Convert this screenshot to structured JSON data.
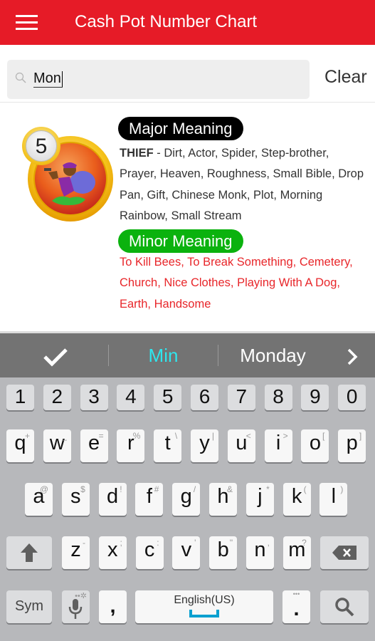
{
  "app": {
    "title": "Cash Pot Number Chart",
    "menu_icon": "hamburger-menu-icon",
    "accent_color": "#e61b27"
  },
  "search": {
    "icon": "search-icon",
    "value": "Mon",
    "placeholder": "",
    "clear_label": "Clear"
  },
  "result": {
    "number": "5",
    "image": "thief-ball-icon",
    "major_label": "Major Meaning",
    "major_keyword": "THIEF",
    "major_rest": " - Dirt, Actor, Spider, Step-brother, Prayer, Heaven, Roughness, Small Bible, Drop Pan, Gift, Chinese Monk, Plot, Morning Rainbow, Small Stream",
    "minor_label": "Minor Meaning",
    "minor_text": "To Kill Bees, To Break Something, Cemetery, Church, Nice Clothes, Playing With A Dog, Earth, Handsome",
    "major_color": "#000000",
    "minor_color": "#0bb20e",
    "minor_text_color": "#e8262a"
  },
  "keyboard": {
    "suggestions": {
      "accept_icon": "checkmark-icon",
      "items": [
        "Min",
        "Monday"
      ],
      "more_icon": "chevron-right-icon",
      "highlight_color": "#2ee6ee"
    },
    "number_row": [
      "1",
      "2",
      "3",
      "4",
      "5",
      "6",
      "7",
      "8",
      "9",
      "0"
    ],
    "row1": [
      {
        "key": "q",
        "alt": "+"
      },
      {
        "key": "w",
        "alt": "_"
      },
      {
        "key": "e",
        "alt": "="
      },
      {
        "key": "r",
        "alt": "%"
      },
      {
        "key": "t",
        "alt": "\\"
      },
      {
        "key": "y",
        "alt": "|"
      },
      {
        "key": "u",
        "alt": "<"
      },
      {
        "key": "i",
        "alt": ">"
      },
      {
        "key": "o",
        "alt": "["
      },
      {
        "key": "p",
        "alt": "]"
      }
    ],
    "row2": [
      {
        "key": "a",
        "alt": "@"
      },
      {
        "key": "s",
        "alt": "$"
      },
      {
        "key": "d",
        "alt": "!"
      },
      {
        "key": "f",
        "alt": "#"
      },
      {
        "key": "g",
        "alt": "/"
      },
      {
        "key": "h",
        "alt": "&"
      },
      {
        "key": "j",
        "alt": "*"
      },
      {
        "key": "k",
        "alt": "("
      },
      {
        "key": "l",
        "alt": ")"
      }
    ],
    "row3": [
      {
        "key": "z",
        "alt": "-"
      },
      {
        "key": "x",
        "alt": ";"
      },
      {
        "key": "c",
        "alt": ":"
      },
      {
        "key": "v",
        "alt": "'"
      },
      {
        "key": "b",
        "alt": "\""
      },
      {
        "key": "n",
        "alt": ","
      },
      {
        "key": "m",
        "alt": "?"
      }
    ],
    "shift_icon": "shift-arrow-icon",
    "backspace_icon": "backspace-icon",
    "sym_label": "Sym",
    "mic_icon": "microphone-icon",
    "comma": ",",
    "space_label": "English(US)",
    "period": ".",
    "search_key_icon": "search-icon"
  }
}
